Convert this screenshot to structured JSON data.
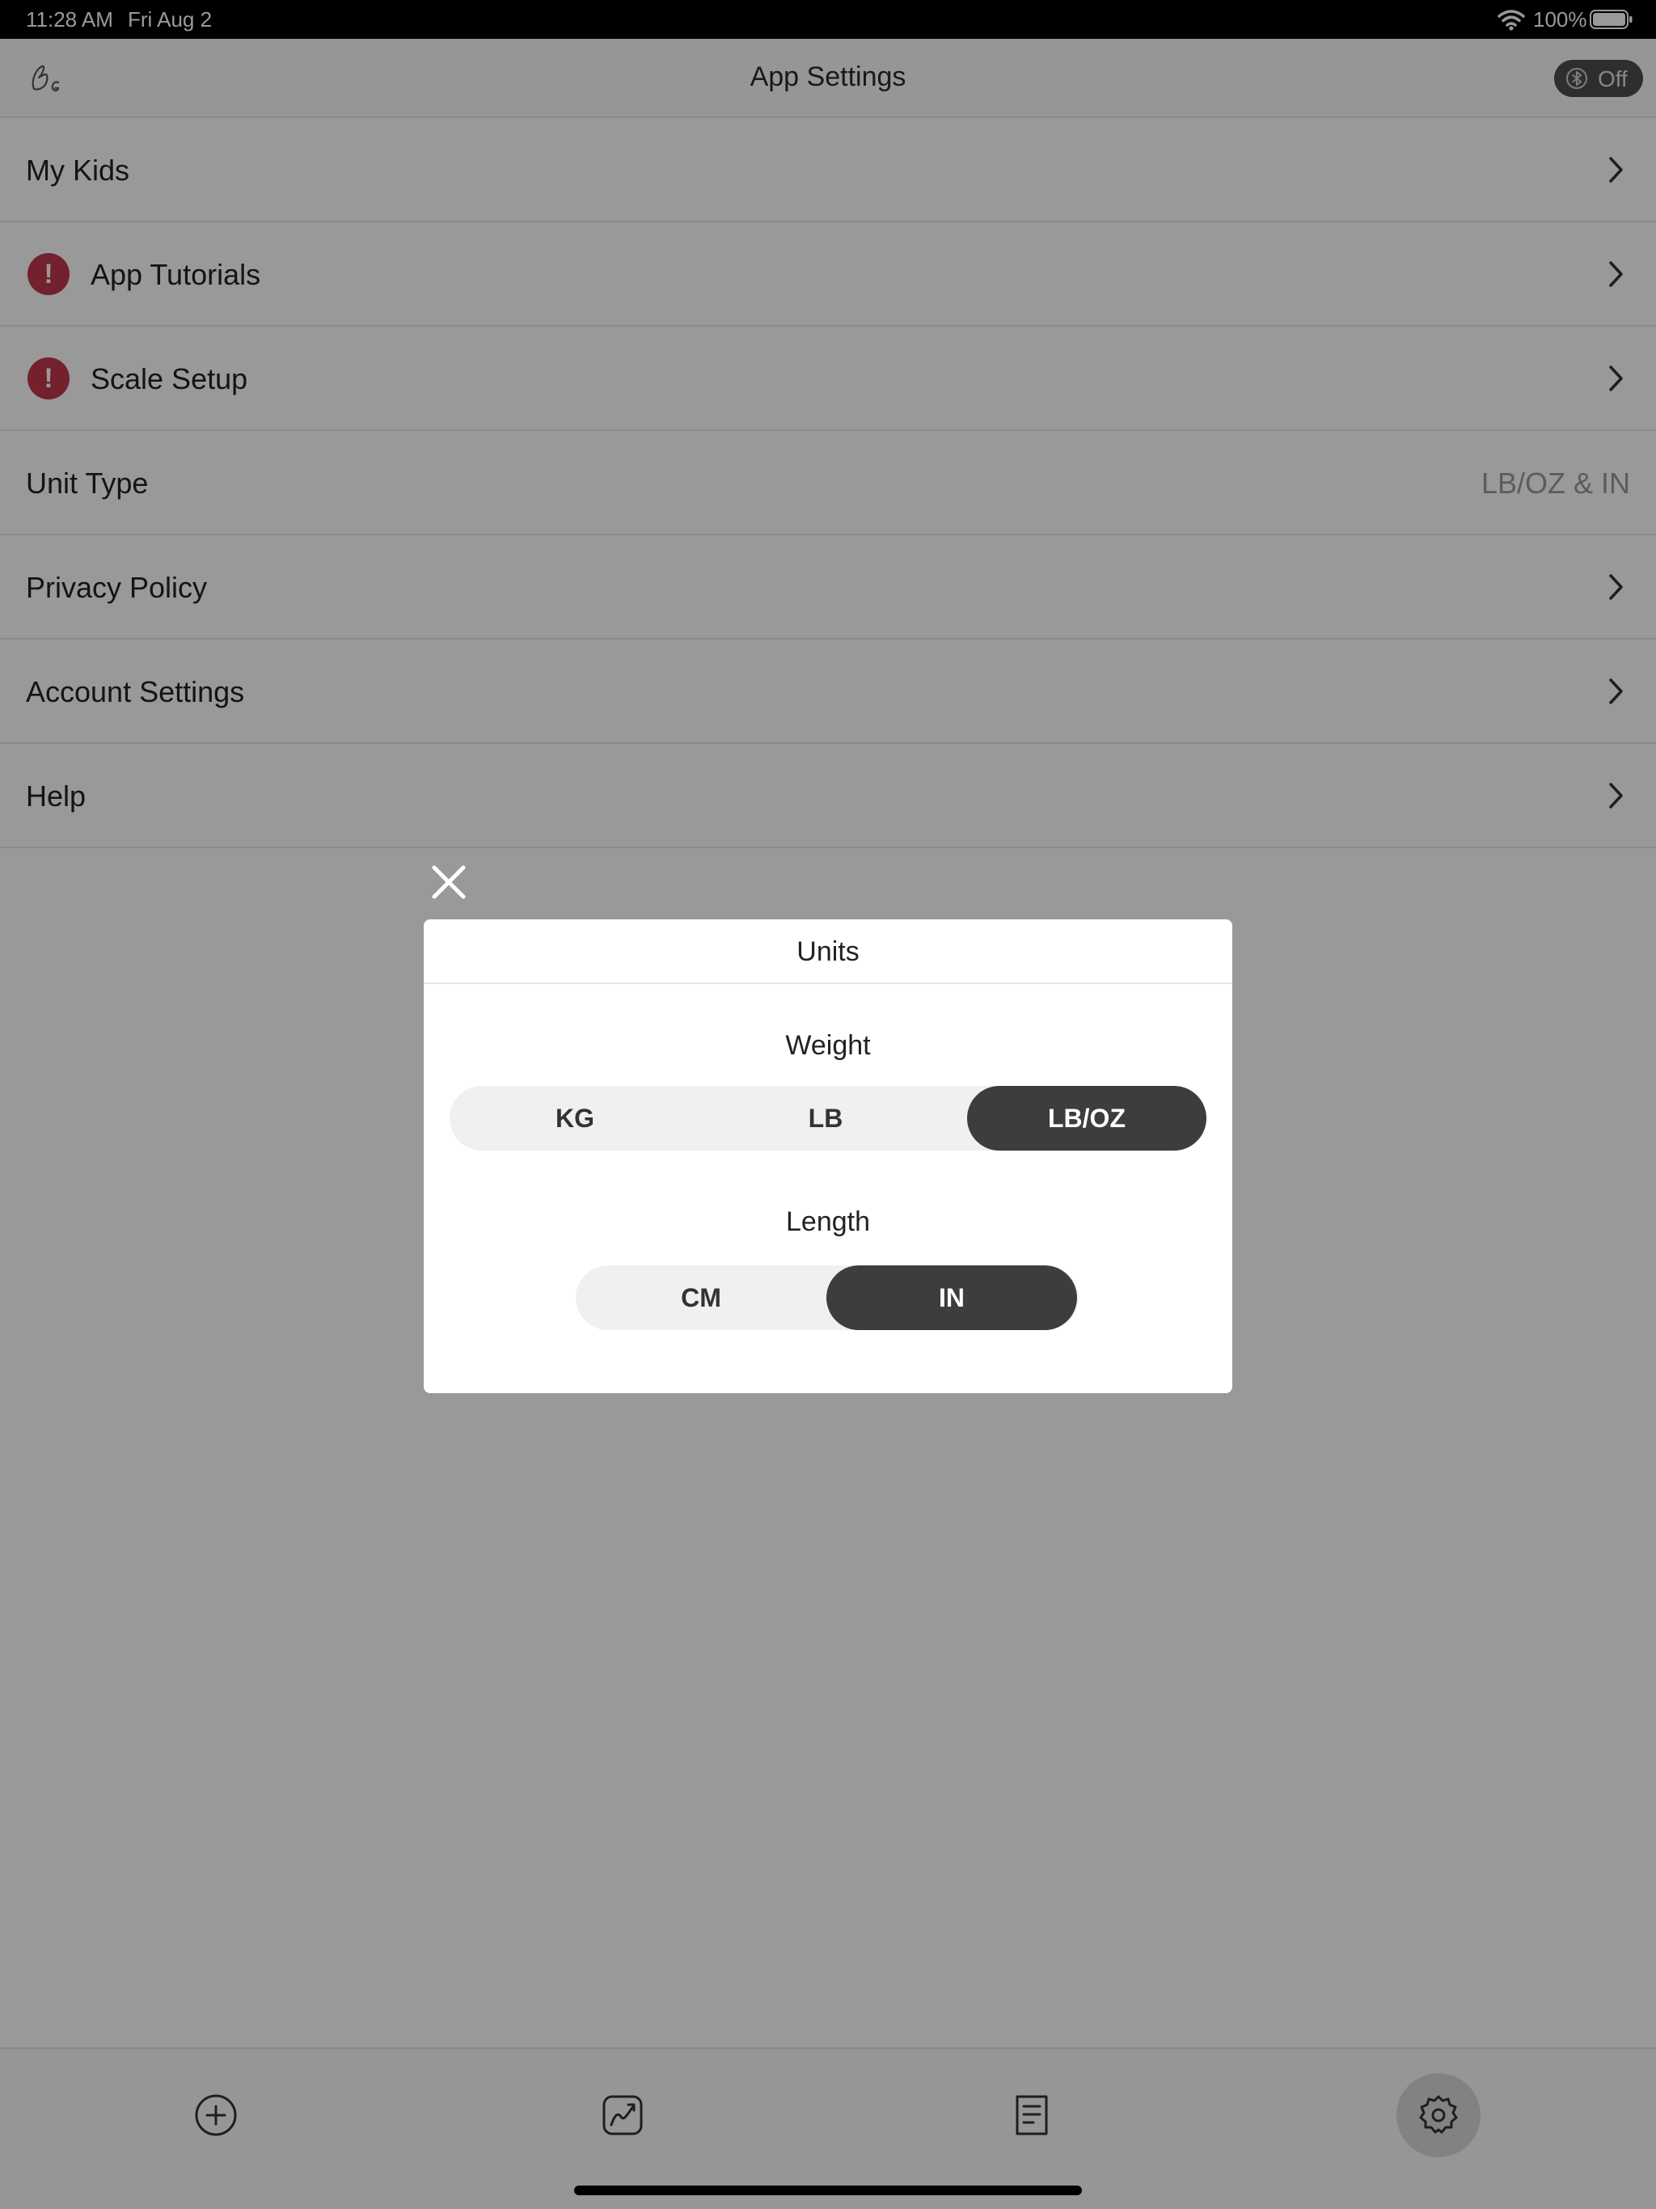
{
  "status_bar": {
    "time": "11:28 AM",
    "date": "Fri Aug 2",
    "battery": "100%"
  },
  "header": {
    "title": "App Settings",
    "bluetooth_status": "Off"
  },
  "settings": {
    "my_kids": "My Kids",
    "app_tutorials": "App Tutorials",
    "scale_setup": "Scale Setup",
    "unit_type": "Unit Type",
    "unit_type_value": "LB/OZ & IN",
    "privacy_policy": "Privacy Policy",
    "account_settings": "Account Settings",
    "help": "Help",
    "alert_glyph": "!"
  },
  "modal": {
    "title": "Units",
    "weight_label": "Weight",
    "weight_options": [
      "KG",
      "LB",
      "LB/OZ"
    ],
    "weight_selected": "LB/OZ",
    "length_label": "Length",
    "length_options": [
      "CM",
      "IN"
    ],
    "length_selected": "IN"
  },
  "tabs": [
    "add-icon",
    "chart-icon",
    "log-icon",
    "settings-icon"
  ],
  "colors": {
    "alert": "#c0374a",
    "selected_segment": "#3d3d3d",
    "overlay": "rgba(0,0,0,0.4)"
  }
}
